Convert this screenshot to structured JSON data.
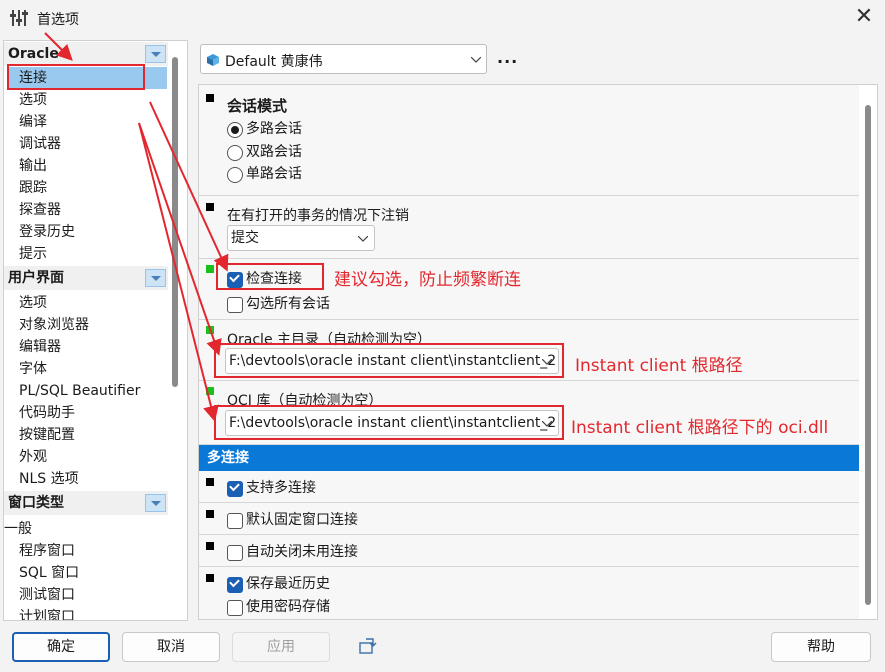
{
  "window": {
    "title": "首选项",
    "close_label": "✕"
  },
  "tree": {
    "categories": [
      {
        "label": "Oracle",
        "items": [
          "连接",
          "选项",
          "编译",
          "调试器",
          "输出",
          "跟踪",
          "探查器",
          "登录历史",
          "提示"
        ]
      },
      {
        "label": "用户界面",
        "items": [
          "选项",
          "对象浏览器",
          "编辑器",
          "字体",
          "PL/SQL Beautifier",
          "代码助手",
          "按键配置",
          "外观",
          "NLS 选项"
        ]
      },
      {
        "label": "窗口类型",
        "items": [
          "一般",
          "程序窗口",
          "SQL 窗口",
          "测试窗口",
          "计划窗口"
        ]
      }
    ],
    "selected": "连接"
  },
  "profile": {
    "value": "Default 黄康伟",
    "more": "..."
  },
  "settings": {
    "session_mode": {
      "title": "会话模式",
      "options": [
        "多路会话",
        "双路会话",
        "单路会话"
      ],
      "selected": "多路会话"
    },
    "logoff": {
      "title": "在有打开的事务的情况下注销",
      "value": "提交"
    },
    "check_connection": {
      "label": "检查连接",
      "checked": true
    },
    "check_all_sessions": {
      "label": "勾选所有会话",
      "checked": false
    },
    "oracle_home": {
      "title": "Oracle 主目录（自动检测为空）",
      "value": "F:\\devtools\\oracle instant client\\instantclient_2"
    },
    "oci_library": {
      "title": "OCI 库（自动检测为空）",
      "value": "F:\\devtools\\oracle instant client\\instantclient_2"
    },
    "multi_connection": {
      "title": "多连接",
      "support_multi": {
        "label": "支持多连接",
        "checked": true
      },
      "default_fixed": {
        "label": "默认固定窗口连接",
        "checked": false
      },
      "auto_close": {
        "label": "自动关闭未用连接",
        "checked": false
      },
      "save_history": {
        "label": "保存最近历史",
        "checked": true
      },
      "password_store": {
        "label": "使用密码存储",
        "checked": false
      }
    }
  },
  "buttons": {
    "ok": "确定",
    "cancel": "取消",
    "apply": "应用",
    "help": "帮助"
  },
  "annotations": {
    "check_note": "建议勾选，防止频繁断连",
    "home_note": "Instant client 根路径",
    "oci_note": "Instant client 根路径下的 oci.dll",
    "color": "#e2282e"
  }
}
